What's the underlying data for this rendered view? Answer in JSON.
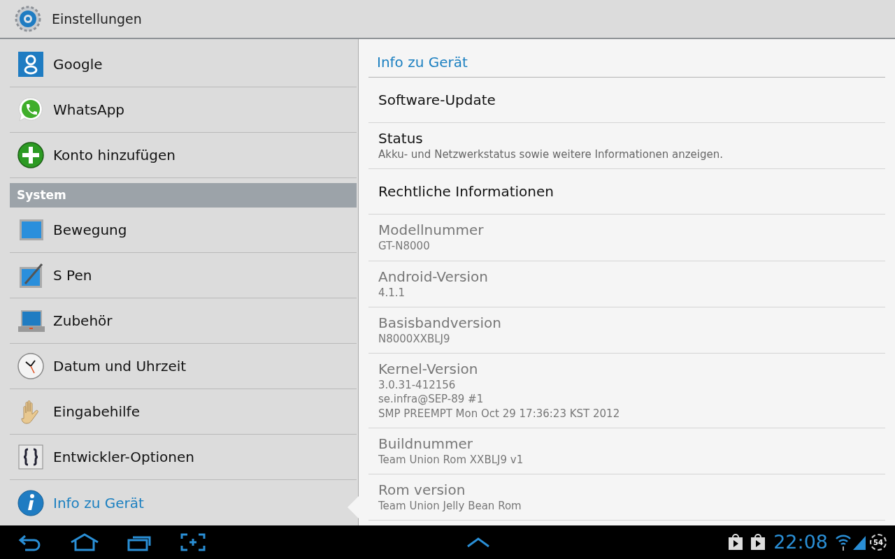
{
  "title_bar": {
    "title": "Einstellungen"
  },
  "sidebar": {
    "items": [
      {
        "kind": "item",
        "label": "Google",
        "selected": false
      },
      {
        "kind": "item",
        "label": "WhatsApp",
        "selected": false
      },
      {
        "kind": "item",
        "label": "Konto hinzufügen",
        "selected": false
      },
      {
        "kind": "header",
        "label": "System"
      },
      {
        "kind": "item",
        "label": "Bewegung",
        "selected": false
      },
      {
        "kind": "item",
        "label": "S Pen",
        "selected": false
      },
      {
        "kind": "item",
        "label": "Zubehör",
        "selected": false
      },
      {
        "kind": "item",
        "label": "Datum und Uhrzeit",
        "selected": false
      },
      {
        "kind": "item",
        "label": "Eingabehilfe",
        "selected": false
      },
      {
        "kind": "item",
        "label": "Entwickler-Optionen",
        "selected": false
      },
      {
        "kind": "item",
        "label": "Info zu Gerät",
        "selected": true
      }
    ]
  },
  "detail": {
    "title": "Info zu Gerät",
    "items": [
      {
        "title": "Software-Update",
        "disabled": false
      },
      {
        "title": "Status",
        "summary": "Akku- und Netzwerkstatus sowie weitere Informationen anzeigen.",
        "disabled": false
      },
      {
        "title": "Rechtliche Informationen",
        "disabled": false
      },
      {
        "title": "Modellnummer",
        "summary": "GT-N8000",
        "disabled": true
      },
      {
        "title": "Android-Version",
        "summary": "4.1.1",
        "disabled": true
      },
      {
        "title": "Basisbandversion",
        "summary": "N8000XXBLJ9",
        "disabled": true
      },
      {
        "title": "Kernel-Version",
        "summary": "3.0.31-412156\nse.infra@SEP-89 #1\nSMP PREEMPT Mon Oct 29 17:36:23 KST 2012",
        "disabled": true
      },
      {
        "title": "Buildnummer",
        "summary": "Team Union Rom XXBLJ9 v1",
        "disabled": true
      },
      {
        "title": "Rom version",
        "summary": "Team Union Jelly Bean Rom",
        "disabled": true
      }
    ]
  },
  "system_bar": {
    "time": "22:08",
    "battery": "54"
  }
}
